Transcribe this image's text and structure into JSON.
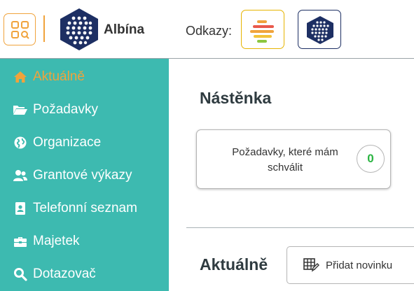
{
  "header": {
    "app_name": "Albína",
    "links_label": "Odkazy:",
    "apps_icon": "app-grid-search-icon",
    "logo_icon": "albina-hexagon-logo",
    "links": [
      {
        "icon": "stripes-logo-icon"
      },
      {
        "icon": "albina-hexagon-logo"
      }
    ]
  },
  "colors": {
    "accent": "#f0a33c",
    "sidebar": "#3dbab0",
    "brand_navy": "#1d2f63",
    "count_green": "#2ab441"
  },
  "sidebar": {
    "items": [
      {
        "label": "Aktuálně",
        "icon": "home-icon",
        "active": true
      },
      {
        "label": "Požadavky",
        "icon": "folder-open-icon"
      },
      {
        "label": "Organizace",
        "icon": "globe-icon"
      },
      {
        "label": "Grantové výkazy",
        "icon": "users-icon"
      },
      {
        "label": "Telefonní seznam",
        "icon": "contact-card-icon"
      },
      {
        "label": "Majetek",
        "icon": "toolbox-icon"
      },
      {
        "label": "Dotazovač",
        "icon": "search-icon"
      }
    ]
  },
  "main": {
    "title": "Nástěnka",
    "card": {
      "label": "Požadavky, které mám schválit",
      "count": "0"
    },
    "news": {
      "title": "Aktuálně",
      "add_label": "Přidat novinku"
    }
  }
}
